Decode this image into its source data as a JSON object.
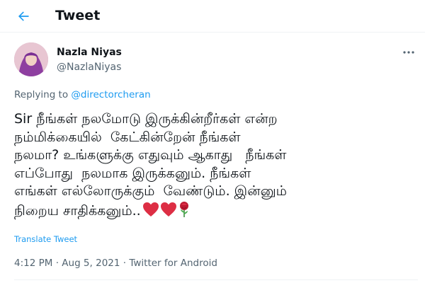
{
  "header": {
    "title": "Tweet",
    "back_icon": "arrow-left-icon",
    "accent_color": "#1d9bf0"
  },
  "tweet": {
    "author_name": "Nazla Niyas",
    "author_handle": "@NazlaNiyas",
    "replying_prefix": "Replying to ",
    "replying_to": "@directorcheran",
    "text_lines": [
      "Sir நீங்கள் நலமோடு இருக்கின்றீர்கள் என்ற",
      "நம்மிக்கையில்  கேட்கின்றேன் நீங்கள்",
      "நலமா? உங்களுக்கு எதுவும் ஆகாது   நீங்கள்",
      "எப்போது  நலமாக இருக்கனும். நீங்கள்",
      "எங்கள் எல்லோருக்கும்  வேண்டும். இன்னும்",
      "நிறைய சாதிக்கனும்.."
    ],
    "emojis": [
      "red-heart-icon",
      "red-heart-icon",
      "rose-icon"
    ],
    "translate_label": "Translate Tweet",
    "time": "4:12 PM",
    "date": "Aug 5, 2021",
    "separator": " · ",
    "source": "Twitter for Android",
    "more_icon": "more-horizontal-icon"
  }
}
